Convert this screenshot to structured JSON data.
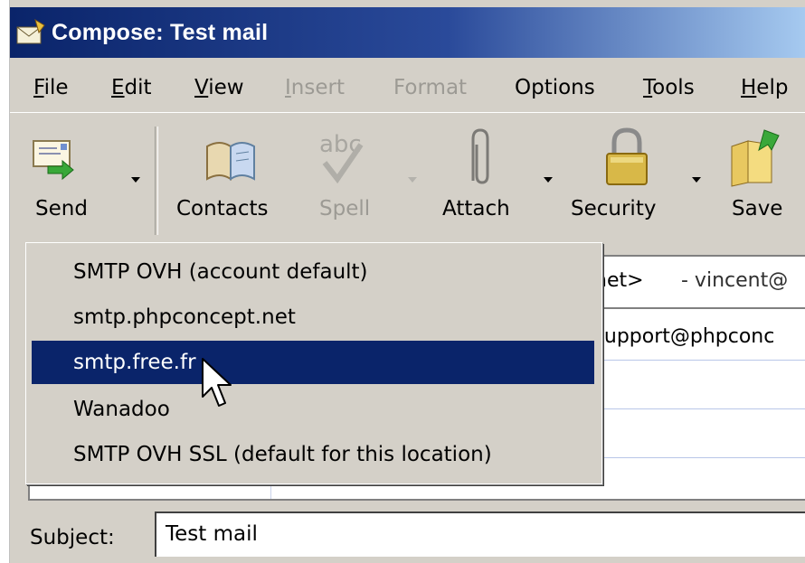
{
  "window": {
    "title": "Compose: Test mail"
  },
  "menu": {
    "items": [
      {
        "label": "File",
        "key": "F",
        "rest": "ile",
        "disabled": false
      },
      {
        "label": "Edit",
        "key": "E",
        "rest": "dit",
        "disabled": false
      },
      {
        "label": "View",
        "key": "V",
        "rest": "iew",
        "disabled": false
      },
      {
        "label": "Insert",
        "key": "I",
        "rest": "nsert",
        "disabled": true
      },
      {
        "label": "Format",
        "disabled": true
      },
      {
        "label": "Options",
        "disabled": false
      },
      {
        "label": "Tools",
        "key": "T",
        "rest": "ools",
        "disabled": false
      },
      {
        "label": "Help",
        "key": "H",
        "rest": "elp",
        "disabled": false
      }
    ]
  },
  "toolbar": {
    "send": "Send",
    "contacts": "Contacts",
    "spell": "Spell",
    "attach": "Attach",
    "security": "Security",
    "save": "Save"
  },
  "address": {
    "row1_left": "net>",
    "row1_right": "- vincent@",
    "row2": ":support@phpconc"
  },
  "subject": {
    "label": "Subject:",
    "value": "Test mail"
  },
  "smtp_dropdown": {
    "items": [
      "SMTP OVH (account default)",
      "smtp.phpconcept.net",
      "smtp.free.fr",
      "Wanadoo",
      "SMTP OVH SSL (default for this location)"
    ],
    "selected_index": 2
  },
  "colors": {
    "selection": "#0a246a",
    "face": "#d4d0c8",
    "title_gradient_start": "#0a246a",
    "title_gradient_end": "#a6caf0"
  }
}
